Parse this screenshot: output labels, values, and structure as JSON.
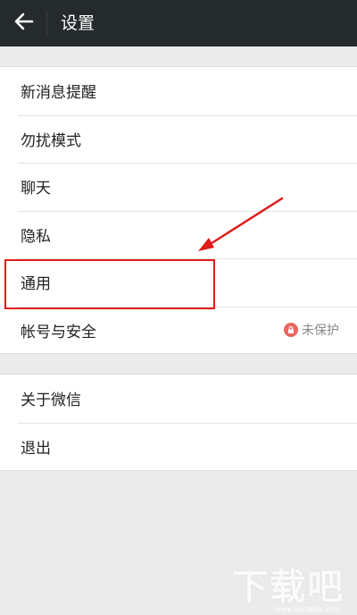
{
  "header": {
    "title": "设置",
    "back_icon": "arrow-left-icon"
  },
  "groups": [
    {
      "items": [
        {
          "label": "新消息提醒"
        },
        {
          "label": "勿扰模式"
        },
        {
          "label": "聊天"
        },
        {
          "label": "隐私"
        },
        {
          "label": "通用"
        },
        {
          "label": "帐号与安全",
          "status": "未保护",
          "status_icon": "lock-icon"
        }
      ]
    },
    {
      "items": [
        {
          "label": "关于微信"
        },
        {
          "label": "退出"
        }
      ]
    }
  ],
  "annotation": {
    "highlight_color": "#e01b1b",
    "highlighted_item": "通用"
  },
  "watermark": {
    "text": "下载吧",
    "url": "www.xiazaiba.com"
  },
  "colors": {
    "topbar": "#252a2c",
    "background": "#ebebeb",
    "status_icon": "#e8685f"
  }
}
